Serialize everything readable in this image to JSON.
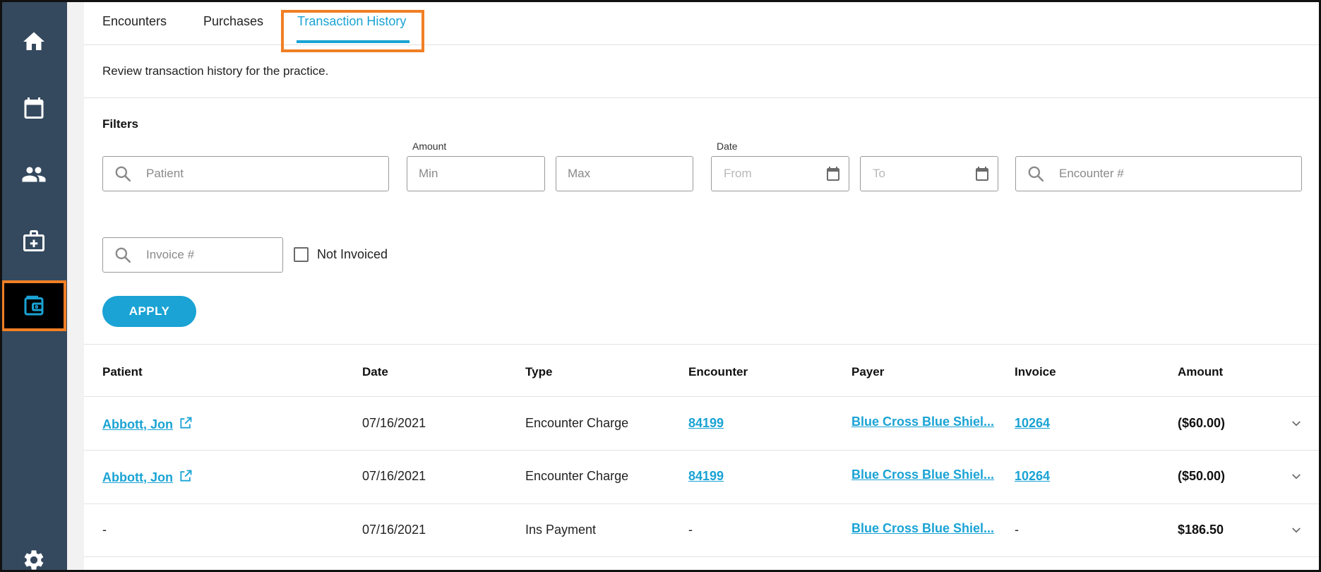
{
  "sidebar": {
    "items": [
      {
        "icon": "home-icon"
      },
      {
        "icon": "calendar-icon"
      },
      {
        "icon": "people-icon"
      },
      {
        "icon": "medical-kit-icon"
      },
      {
        "icon": "wallet-icon",
        "active": true
      },
      {
        "icon": "gear-icon"
      }
    ]
  },
  "tabs": {
    "encounters": "Encounters",
    "purchases": "Purchases",
    "transaction_history": "Transaction History",
    "active": "Transaction History"
  },
  "description": "Review transaction history for the practice.",
  "filters": {
    "title": "Filters",
    "patient_placeholder": "Patient",
    "amount_label": "Amount",
    "min_placeholder": "Min",
    "max_placeholder": "Max",
    "date_label": "Date",
    "from_placeholder": "From",
    "to_placeholder": "To",
    "encounter_placeholder": "Encounter #",
    "invoice_placeholder": "Invoice #",
    "not_invoiced_label": "Not Invoiced",
    "not_invoiced_checked": false,
    "apply_label": "APPLY"
  },
  "table": {
    "headers": {
      "patient": "Patient",
      "date": "Date",
      "type": "Type",
      "encounter": "Encounter",
      "payer": "Payer",
      "invoice": "Invoice",
      "amount": "Amount"
    },
    "rows": [
      {
        "patient": "Abbott, Jon",
        "date": "07/16/2021",
        "type": "Encounter Charge",
        "encounter": "84199",
        "payer": "Blue Cross Blue Shiel...",
        "invoice": "10264",
        "amount": "($60.00)"
      },
      {
        "patient": "Abbott, Jon",
        "date": "07/16/2021",
        "type": "Encounter Charge",
        "encounter": "84199",
        "payer": "Blue Cross Blue Shiel...",
        "invoice": "10264",
        "amount": "($50.00)"
      },
      {
        "patient": "-",
        "date": "07/16/2021",
        "type": "Ins Payment",
        "encounter": "-",
        "payer": "Blue Cross Blue Shiel...",
        "invoice": "-",
        "amount": "$186.50"
      }
    ]
  },
  "colors": {
    "accent": "#1aa3d4",
    "sidebar": "#34495e",
    "highlight": "#f07f25"
  }
}
